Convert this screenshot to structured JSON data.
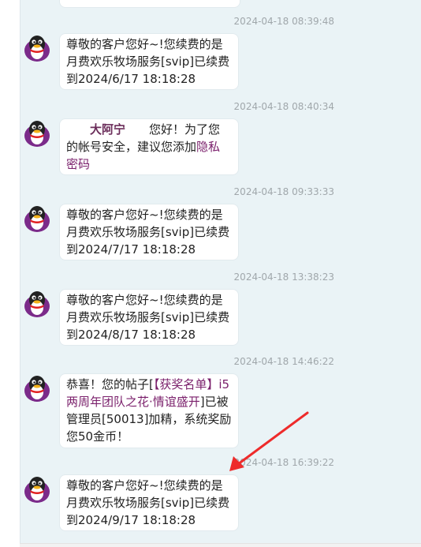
{
  "messages": [
    {
      "time": "2024-04-18 08:39:48",
      "text": "尊敬的客户您好~!您续费的是月费欢乐牧场服务[svip]已续费到2024/6/17 18:18:28"
    },
    {
      "time": "2024-04-18 08:40:34",
      "name": "大阿宁",
      "greeting": "您好！为了您的帐号安全，建议您添加",
      "link": "隐私密码"
    },
    {
      "time": "2024-04-18 09:33:33",
      "text": "尊敬的客户您好~!您续费的是月费欢乐牧场服务[svip]已续费到2024/7/17 18:18:28"
    },
    {
      "time": "2024-04-18 13:38:23",
      "text": "尊敬的客户您好~!您续费的是月费欢乐牧场服务[svip]已续费到2024/8/17 18:18:28"
    },
    {
      "time": "2024-04-18 14:46:22",
      "prefix": "恭喜！您的帖子[",
      "link": "【获奖名单】i5两周年团队之花·情谊盛开",
      "suffix": "]已被管理员[50013]加精，系统奖励您50金币！"
    },
    {
      "time": "2024-04-18 16:39:22",
      "text": "尊敬的客户您好~!您续费的是月费欢乐牧场服务[svip]已续费到2024/9/17 18:18:28"
    }
  ],
  "colors": {
    "accent": "#ee2b2b",
    "link": "#7a1f6b",
    "panel": "#eaf3f6"
  },
  "icons": {
    "avatar": "qq-penguin-icon",
    "annotation": "red-arrow-icon"
  }
}
